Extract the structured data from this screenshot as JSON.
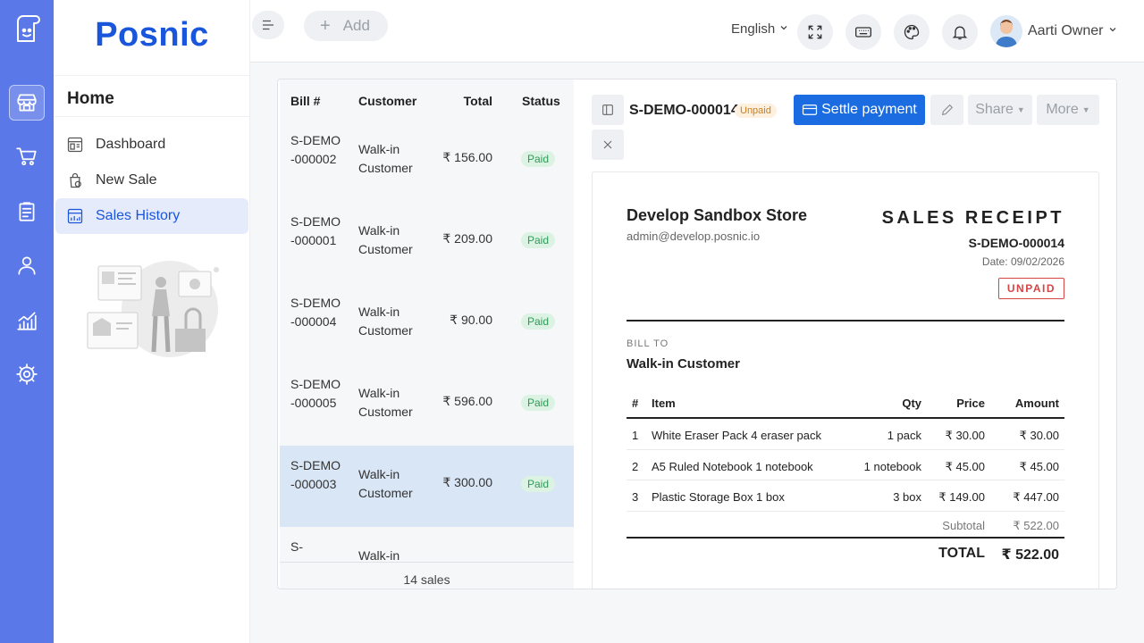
{
  "app": {
    "brand": "Posnic"
  },
  "rail": {
    "items": [
      {
        "icon": "store-icon",
        "active": true
      },
      {
        "icon": "cart-icon",
        "active": false
      },
      {
        "icon": "clipboard-icon",
        "active": false
      },
      {
        "icon": "user-icon",
        "active": false
      },
      {
        "icon": "reports-icon",
        "active": false
      },
      {
        "icon": "settings-icon",
        "active": false
      }
    ]
  },
  "sidebar": {
    "section": "Home",
    "items": [
      {
        "label": "Dashboard",
        "icon": "dashboard-icon",
        "active": false
      },
      {
        "label": "New Sale",
        "icon": "new-sale-icon",
        "active": false
      },
      {
        "label": "Sales History",
        "icon": "sales-history-icon",
        "active": true
      }
    ]
  },
  "topbar": {
    "add_label": "Add",
    "language": "English",
    "user_name": "Aarti Owner"
  },
  "sales_list": {
    "headers": {
      "bill": "Bill #",
      "customer": "Customer",
      "total": "Total",
      "status": "Status"
    },
    "rows": [
      {
        "bill": "S-DEMO-000002",
        "customer": "Walk-in Customer",
        "total": "₹ 156.00",
        "status": "Paid"
      },
      {
        "bill": "S-DEMO-000001",
        "customer": "Walk-in Customer",
        "total": "₹ 209.00",
        "status": "Paid"
      },
      {
        "bill": "S-DEMO-000004",
        "customer": "Walk-in Customer",
        "total": "₹ 90.00",
        "status": "Paid"
      },
      {
        "bill": "S-DEMO-000005",
        "customer": "Walk-in Customer",
        "total": "₹ 596.00",
        "status": "Paid"
      },
      {
        "bill": "S-DEMO-000003",
        "customer": "Walk-in Customer",
        "total": "₹ 300.00",
        "status": "Paid"
      },
      {
        "bill": "S-",
        "customer": "Walk-in",
        "total": "",
        "status": ""
      }
    ],
    "footer": "14 sales"
  },
  "detail": {
    "bill_no": "S-DEMO-000014",
    "status_badge": "Unpaid",
    "settle_label": "Settle payment",
    "share_label": "Share",
    "more_label": "More"
  },
  "receipt": {
    "store": "Develop Sandbox Store",
    "email": "admin@develop.posnic.io",
    "title": "SALES RECEIPT",
    "bill_no": "S-DEMO-000014",
    "date": "Date: 09/02/2026",
    "status": "UNPAID",
    "bill_to_label": "BILL TO",
    "customer": "Walk-in Customer",
    "headers": {
      "num": "#",
      "item": "Item",
      "qty": "Qty",
      "price": "Price",
      "amount": "Amount"
    },
    "items": [
      {
        "num": "1",
        "item": "White Eraser Pack 4 eraser pack",
        "qty": "1 pack",
        "price": "₹ 30.00",
        "amount": "₹ 30.00"
      },
      {
        "num": "2",
        "item": "A5 Ruled Notebook 1 notebook",
        "qty": "1 notebook",
        "price": "₹ 45.00",
        "amount": "₹ 45.00"
      },
      {
        "num": "3",
        "item": "Plastic Storage Box 1 box",
        "qty": "3 box",
        "price": "₹ 149.00",
        "amount": "₹ 447.00"
      }
    ],
    "subtotal_label": "Subtotal",
    "subtotal": "₹ 522.00",
    "total_label": "TOTAL",
    "total": "₹ 522.00"
  }
}
